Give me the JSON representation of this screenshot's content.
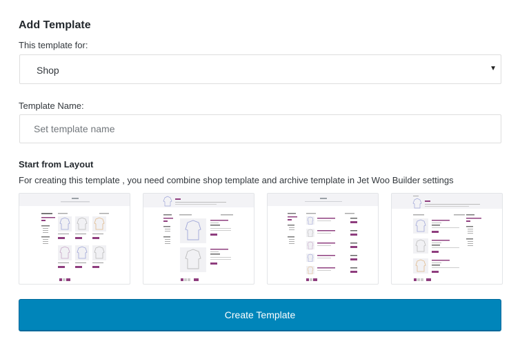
{
  "heading": "Add Template",
  "template_for": {
    "label": "This template for:",
    "selected": "Shop"
  },
  "template_name": {
    "label": "Template Name:",
    "placeholder": "Set template name",
    "value": ""
  },
  "layout": {
    "title": "Start from Layout",
    "description": "For creating this template , you need combine shop template and archive template in Jet Woo Builder settings",
    "options": [
      {
        "id": "layout-1",
        "style": "grid-3-columns-with-sidebar"
      },
      {
        "id": "layout-2",
        "style": "list-large-images-with-sidebar"
      },
      {
        "id": "layout-3",
        "style": "list-compact-with-sidebar"
      },
      {
        "id": "layout-4",
        "style": "list-with-right-sidebar"
      }
    ]
  },
  "create_button": {
    "label": "Create Template"
  },
  "colors": {
    "primary_button": "#0085ba",
    "accent_purple": "#8e3d7e"
  }
}
